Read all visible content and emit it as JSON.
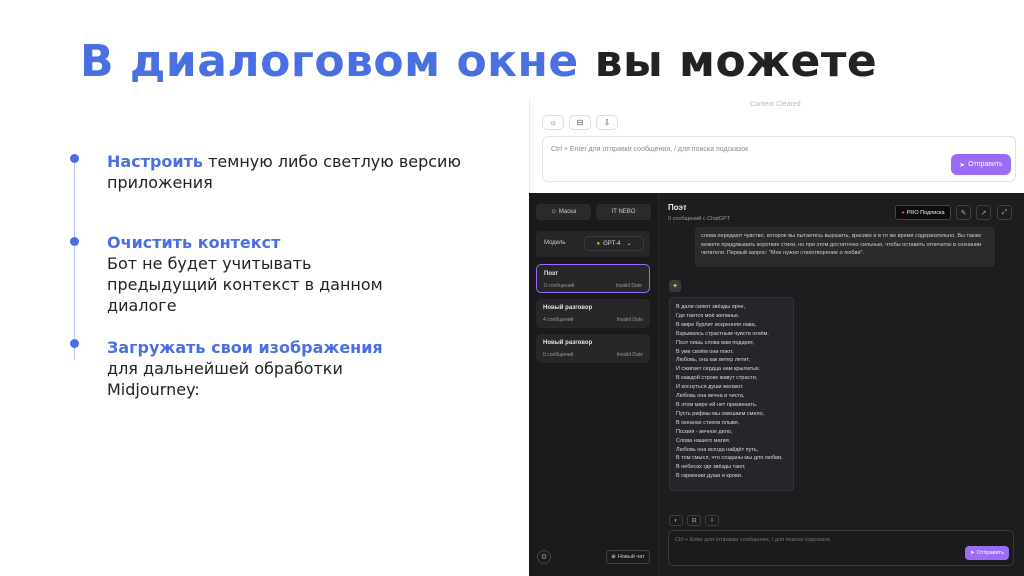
{
  "title": {
    "highlight": "В диалоговом окне",
    "rest": "вы можете"
  },
  "bullets": [
    {
      "strong": "Настроить",
      "text": " темную либо светлую версию приложения"
    },
    {
      "strong": "Очистить контекст",
      "text": "Бот не будет учитывать предыдущий контекст в данном диалоге"
    },
    {
      "strong": "Загружать свои изображения",
      "text": "для дальнейшей обработки Midjourney:"
    }
  ],
  "light_ui": {
    "context_cleared": "Context Cleared",
    "input_placeholder": "Ctrl + Enter для отправки сообщения, / для поиска подсказок",
    "send_label": "Отправить"
  },
  "dark_ui": {
    "sidebar": {
      "mask_label": "Маска",
      "itnebo_label": "IT NEBO",
      "model_label": "Модель",
      "model_value": "GPT-4",
      "conversations": [
        {
          "name": "Поэт",
          "count": "0 сообщений",
          "date": "Invalid Date"
        },
        {
          "name": "Новый разговор",
          "count": "4 сообщений",
          "date": "Invalid Date"
        },
        {
          "name": "Новый разговор",
          "count": "0 сообщений",
          "date": "Invalid Date"
        }
      ],
      "new_chat": "Новый чат"
    },
    "header": {
      "title": "Поэт",
      "subtitle": "0 сообщений с ChatGPT",
      "pro_label": "PRO Подписка"
    },
    "user_message": "слова передают чувство, которое вы пытаетесь выразить, красиво и в то же время содержательно. Вы также можете придумывать короткие стихи, но при этом достаточно сильные, чтобы оставить отпечаток в сознании читателя. Первый запрос: \"Мне нужно стихотворение о любви\".",
    "poem": [
      "В дали сияют звёзды ярче,",
      "Где таится моё желанье.",
      "В мире бурлит искренняя лава,",
      "Взрываясь страстным чувств огнём.",
      "Поэт пишь слова вам подарит,",
      "В уме своём они поют.",
      "Любовь, она как ветер летит,",
      "И сжигает сердца нам крылатых.",
      "В каждой строке живут страсти,",
      "И коснуться души желают.",
      "Любовь она вечна и чиста,",
      "В этом мире ей нет призвенить.",
      "Пусть рифмы мы смешаем смело,",
      "В океанах стихов плывя,",
      "Поэзия - вечное дело,",
      "Слова нашего магия.",
      "Любовь она всегда найдёт путь,",
      "В том смысл, что созданы мы для любви,",
      "В небесах где звёзды тают,",
      "В гармонии души и крови."
    ],
    "input_placeholder": "Ctrl + Enter для отправки сообщения, / для поиска подсказок",
    "send_label": "Отправить"
  }
}
